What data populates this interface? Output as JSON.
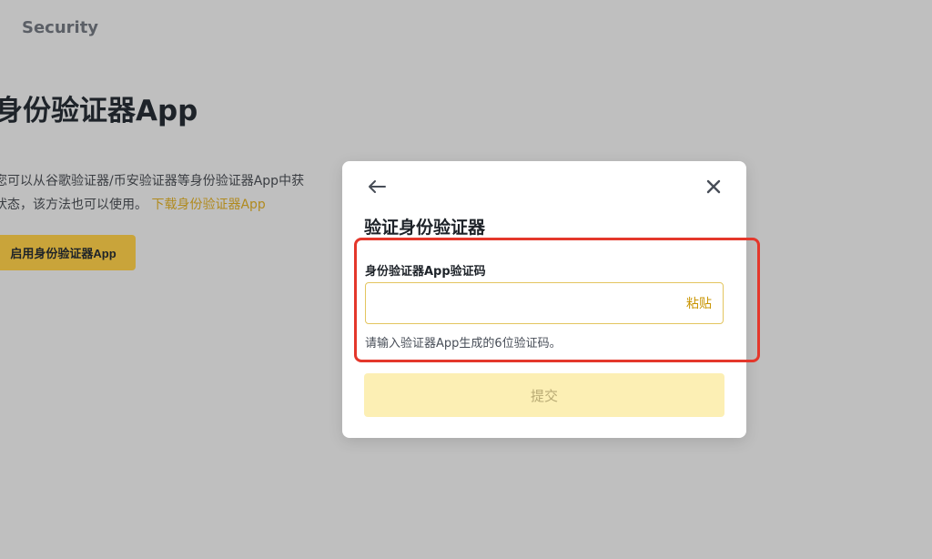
{
  "background": {
    "section_label": "Security",
    "title": "身份验证器App",
    "description_line1": "您可以从谷歌验证器/币安验证器等身份验证器App中获",
    "description_line2": "状态，该方法也可以使用。",
    "download_link": "下载身份验证器App",
    "enable_button": "启用身份验证器App"
  },
  "modal": {
    "title": "验证身份验证器",
    "field_label": "身份验证器App验证码",
    "input_value": "",
    "paste_label": "粘贴",
    "hint": "请输入验证器App生成的6位验证码。",
    "submit_label": "提交"
  },
  "icons": {
    "back": "back-arrow-icon",
    "close": "close-icon"
  },
  "colors": {
    "accent": "#c99400",
    "input_border": "#e3c55f",
    "submit_disabled_bg": "#fcefb4",
    "highlight": "#e4372b"
  }
}
